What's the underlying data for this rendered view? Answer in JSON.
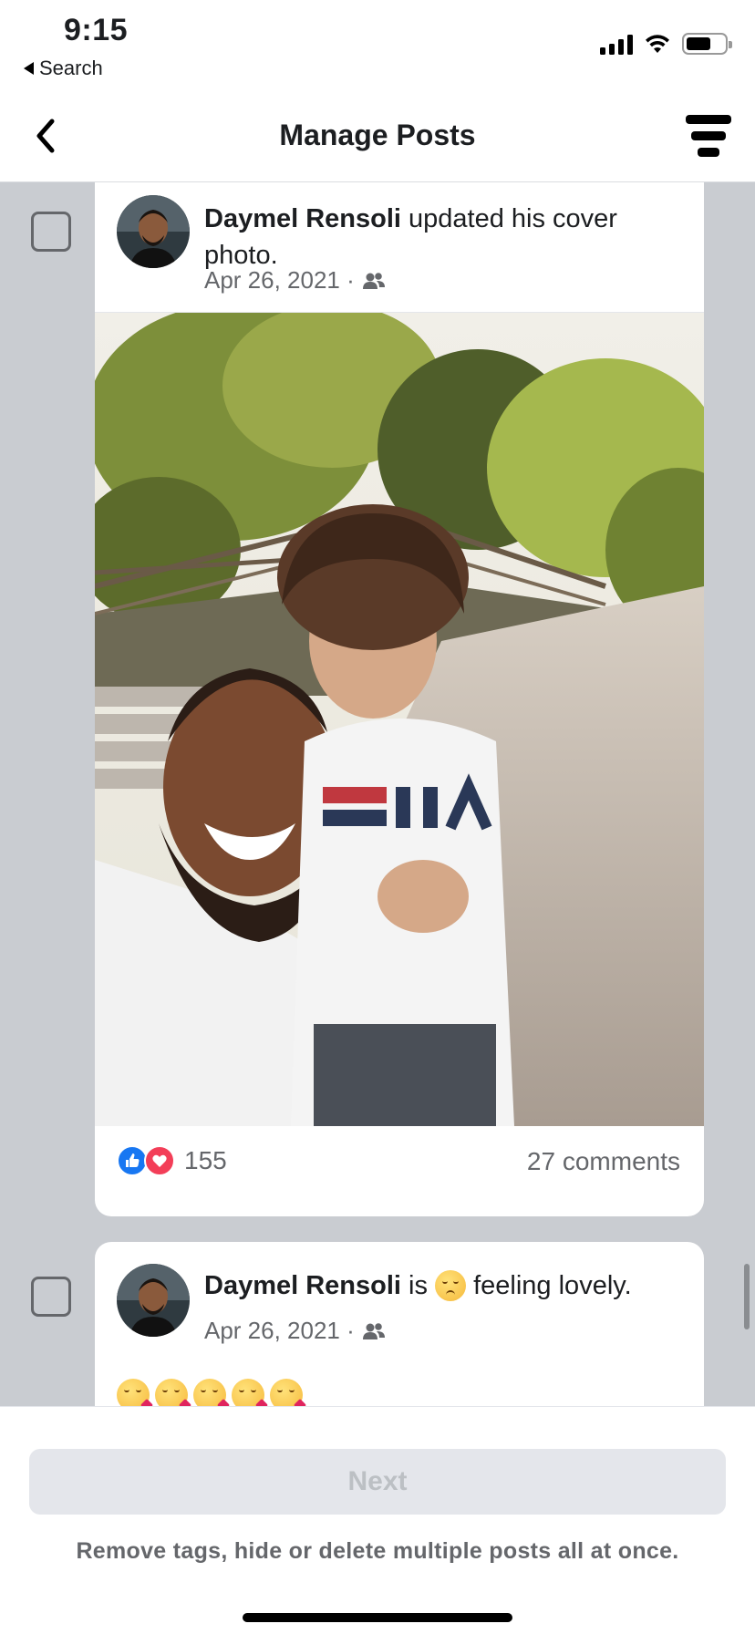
{
  "status_bar": {
    "time": "9:15",
    "back_app_label": "Search",
    "icons": [
      "signal-icon",
      "wifi-icon",
      "battery-icon"
    ]
  },
  "nav": {
    "title": "Manage Posts",
    "back_icon": "chevron-left-icon",
    "filter_icon": "filter-icon"
  },
  "posts": [
    {
      "author": "Daymel Rensoli",
      "action": " updated his cover photo.",
      "date": "Apr 26, 2021 ·",
      "audience_icon": "friends-icon",
      "reaction_icons": [
        "like-icon",
        "love-icon"
      ],
      "reaction_count": "155",
      "comments": "27 comments"
    },
    {
      "author": "Daymel Rensoli",
      "action_pre": " is ",
      "feeling_icon": "smiling-hearts-emoji",
      "action_post": " feeling lovely.",
      "date": "Apr 26, 2021 ·",
      "audience_icon": "friends-icon",
      "emoji_body": [
        "kissing-face-emoji",
        "kissing-face-emoji",
        "kissing-face-emoji",
        "kissing-face-emoji",
        "kissing-face-emoji"
      ]
    }
  ],
  "bottom": {
    "next_label": "Next",
    "helper": "Remove tags, hide or delete multiple posts all at once."
  },
  "colors": {
    "accent": "#1877f2",
    "love": "#f33e58",
    "feed_bg": "#c9ccd1",
    "secondary_text": "#65676b"
  }
}
